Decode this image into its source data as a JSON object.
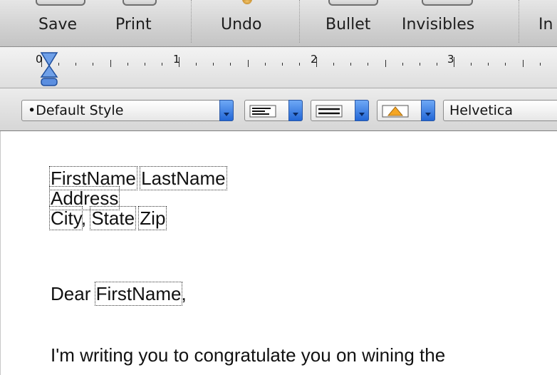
{
  "toolbar": {
    "save_label": "Save",
    "print_label": "Print",
    "undo_label": "Undo",
    "bullet_label": "Bullet",
    "invisibles_label": "Invisibles",
    "cut_label": "In"
  },
  "ruler": {
    "numbers": [
      "0",
      "1",
      "2",
      "3"
    ]
  },
  "formatbar": {
    "style_value": "•Default Style",
    "alignment_icon": "align-left-icon",
    "spacing_icon": "line-spacing-icon",
    "list_icon": "list-warning-icon",
    "font_value": "Helvetica"
  },
  "document": {
    "address_first": "FirstName",
    "address_last": "LastName",
    "address_line": "Address",
    "city": "City",
    "comma": ",",
    "state": "State",
    "zip": "Zip",
    "dear": "Dear ",
    "dear_name": "FirstName",
    "dear_comma": ",",
    "body_line": "I'm writing you to congratulate you on wining the"
  }
}
